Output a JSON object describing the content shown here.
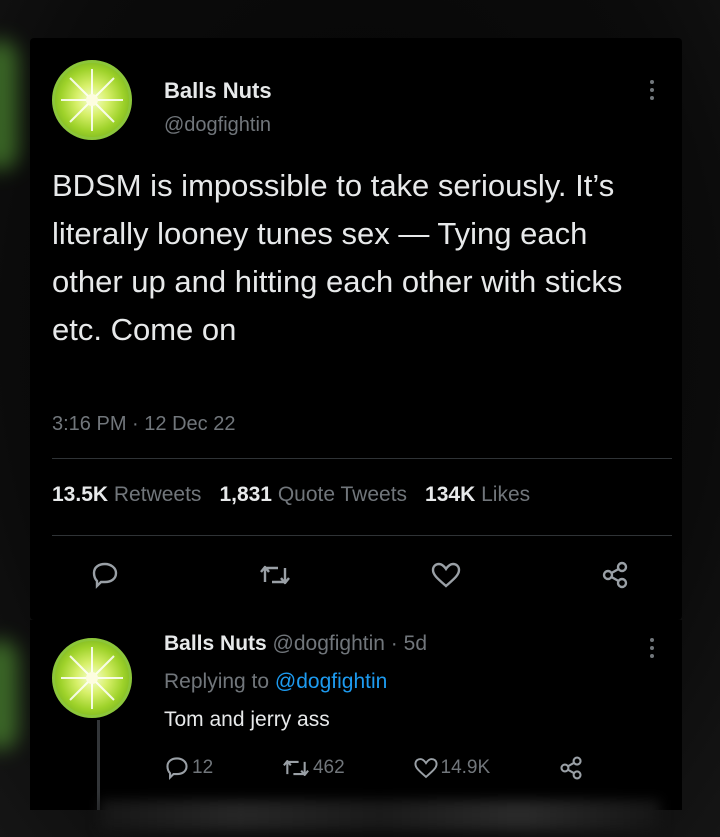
{
  "tweet": {
    "display_name": "Balls Nuts",
    "handle": "@dogfightin",
    "text": "BDSM is impossible to take seriously. It’s literally looney tunes sex — Tying each other up and hitting each other with sticks etc. Come on",
    "time": "3:16 PM",
    "date": "12 Dec 22",
    "separator": "·",
    "stats": {
      "retweets_count": "13.5K",
      "retweets_label": "Retweets",
      "quotes_count": "1,831",
      "quotes_label": "Quote Tweets",
      "likes_count": "134K",
      "likes_label": "Likes"
    }
  },
  "reply": {
    "display_name": "Balls Nuts",
    "handle": "@dogfightin",
    "age": "5d",
    "separator": "·",
    "replying_label": "Replying to",
    "replying_handle": "@dogfightin",
    "text": "Tom and jerry ass",
    "reply_count": "12",
    "retweet_count": "462",
    "like_count": "14.9K"
  },
  "icons": {
    "reply": "reply-icon",
    "retweet": "retweet-icon",
    "like": "heart-icon",
    "share": "share-icon",
    "more": "more-icon"
  },
  "colors": {
    "background": "#000000",
    "text": "#e7e9ea",
    "muted": "#71767b",
    "link": "#1d9bf0",
    "avatar_green": "#9ed22a"
  }
}
